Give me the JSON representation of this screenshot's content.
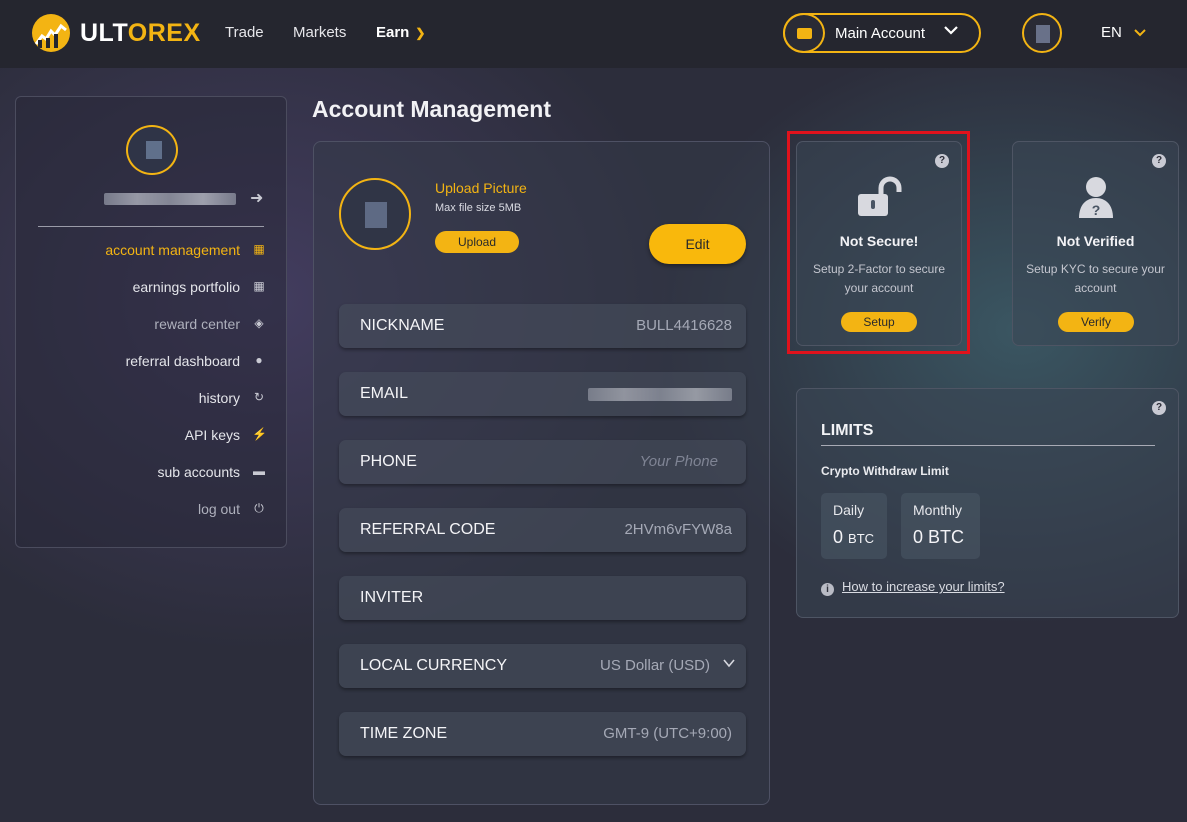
{
  "brand": {
    "name_part1": "ULT",
    "name_part2": "OREX",
    "accent": "#f3b413"
  },
  "nav": {
    "trade": "Trade",
    "markets": "Markets",
    "earn": "Earn"
  },
  "account_selector": {
    "label": "Main Account"
  },
  "language": "EN",
  "sidebar": {
    "items": [
      {
        "label": "account management",
        "icon": "account-icon",
        "active": true
      },
      {
        "label": "earnings portfolio",
        "icon": "portfolio-icon"
      },
      {
        "label": "reward center",
        "icon": "gift-icon"
      },
      {
        "label": "referral dashboard",
        "icon": "users-icon"
      },
      {
        "label": "history",
        "icon": "history-icon"
      },
      {
        "label": "API keys",
        "icon": "plug-icon"
      },
      {
        "label": "sub accounts",
        "icon": "wallet-icon"
      },
      {
        "label": "log out",
        "icon": "power-icon"
      }
    ]
  },
  "page": {
    "title": "Account Management"
  },
  "profile": {
    "upload_title": "Upload Picture",
    "upload_max": "Max file size 5MB",
    "upload_button": "Upload",
    "edit_button": "Edit"
  },
  "fields": [
    {
      "label": "NICKNAME",
      "value": "BULL4416628"
    },
    {
      "label": "EMAIL",
      "value": ""
    },
    {
      "label": "PHONE",
      "placeholder": "Your Phone"
    },
    {
      "label": "REFERRAL CODE",
      "value": "2HVm6vFYW8a"
    },
    {
      "label": "INVITER",
      "value": ""
    },
    {
      "label": "LOCAL CURRENCY",
      "value": "US Dollar (USD)"
    },
    {
      "label": "TIME ZONE",
      "value": "GMT-9 (UTC+9:00)"
    }
  ],
  "security_card": {
    "title": "Not Secure!",
    "description": "Setup 2-Factor to secure your account",
    "button": "Setup"
  },
  "kyc_card": {
    "title": "Not Verified",
    "description": "Setup KYC to secure your account",
    "button": "Verify"
  },
  "limits": {
    "title": "LIMITS",
    "subtitle": "Crypto Withdraw Limit",
    "daily": {
      "label": "Daily",
      "amount": "0",
      "unit": "BTC"
    },
    "monthly": {
      "label": "Monthly",
      "amount": "0",
      "unit": "BTC"
    },
    "help_link": "How to increase your limits?"
  },
  "help_mark": "?",
  "info_mark": "i"
}
